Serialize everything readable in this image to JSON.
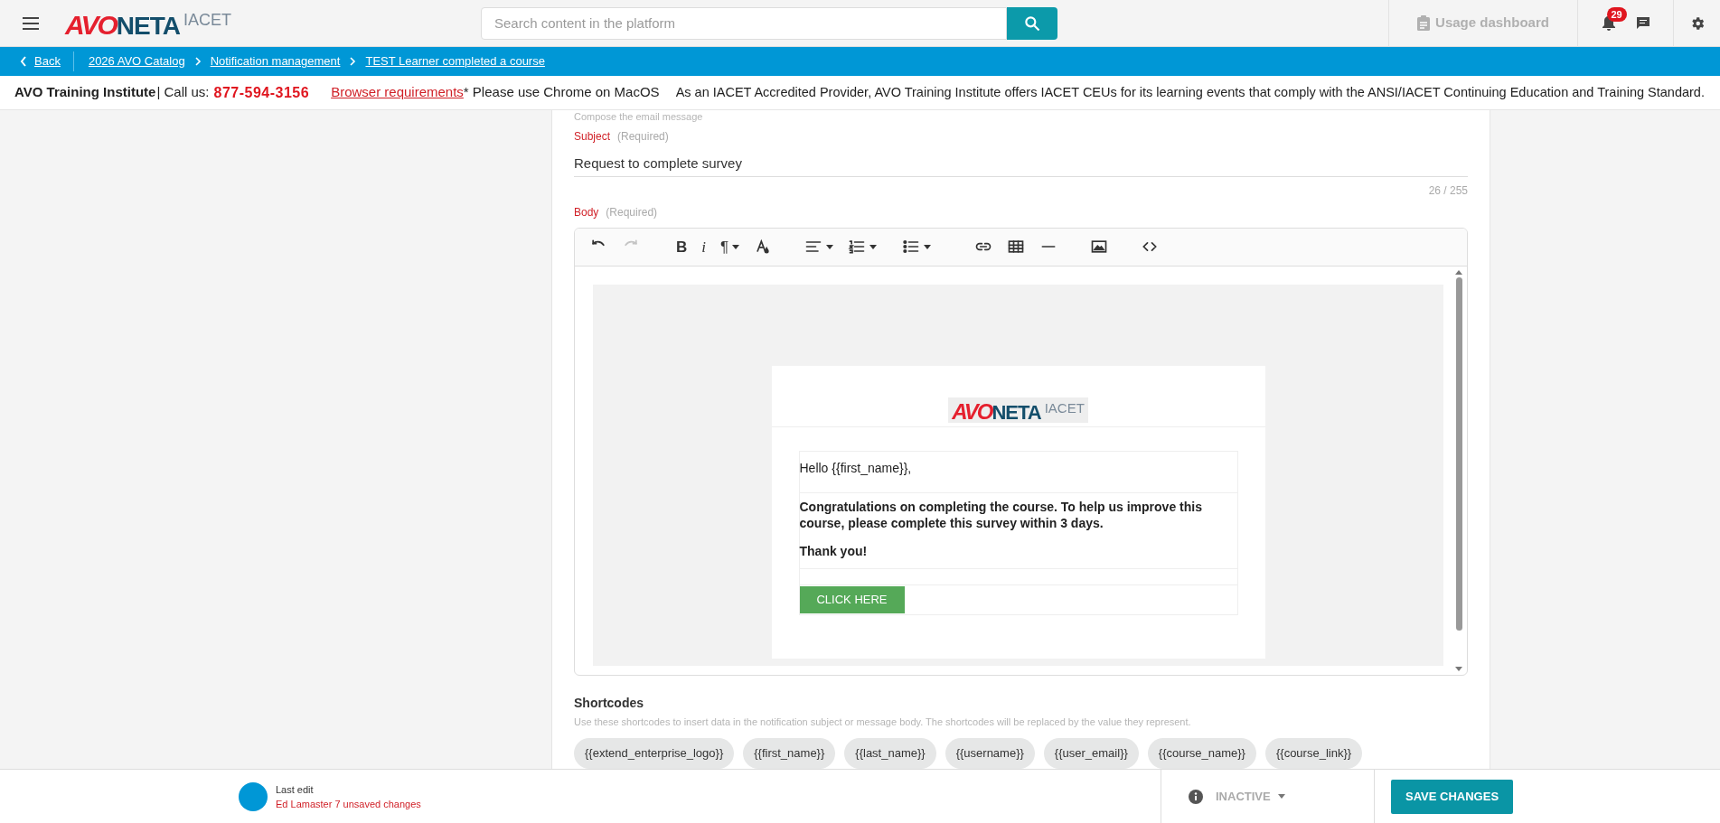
{
  "header": {
    "logo": {
      "part_1": "AVO",
      "part_2": "NETA",
      "part_3": "IACET"
    },
    "search": {
      "placeholder": "Search content in the platform"
    },
    "usage_dashboard": "Usage dashboard",
    "notifications_count": "29"
  },
  "breadcrumb": {
    "back": "Back",
    "items": [
      "2026 AVO Catalog",
      "Notification management",
      "TEST Learner completed a course"
    ]
  },
  "info_strip": {
    "institute": "AVO Training Institute",
    "call_us": "| Call us:",
    "phone": "877-594-3156",
    "browser_link": "Browser requirements",
    "browser_note": "* Please use Chrome on MacOS",
    "accreditation": "As an IACET Accredited Provider, AVO Training Institute offers IACET CEUs for its learning events that comply with the ANSI/IACET Continuing Education and Training Standard."
  },
  "form": {
    "section_hint": "Compose the email message",
    "subject": {
      "label": "Subject",
      "required": "(Required)",
      "value": "Request to complete survey",
      "counter": "26 / 255"
    },
    "body": {
      "label": "Body",
      "required": "(Required)",
      "toolbar": [
        {
          "kind": "undo",
          "disabled": false
        },
        {
          "kind": "redo",
          "disabled": true
        },
        {
          "kind": "bold",
          "text": "B",
          "disabled": false
        },
        {
          "kind": "italic",
          "text": "i",
          "disabled": false
        },
        {
          "kind": "paragraph",
          "text": "¶",
          "disabled": false,
          "dropdown": true
        },
        {
          "kind": "text-color",
          "disabled": false
        },
        {
          "kind": "align",
          "disabled": false,
          "dropdown": true
        },
        {
          "kind": "ordered-list",
          "disabled": false,
          "dropdown": true
        },
        {
          "kind": "bullet-list",
          "disabled": false,
          "dropdown": true
        },
        {
          "kind": "link",
          "disabled": false
        },
        {
          "kind": "table",
          "disabled": false
        },
        {
          "kind": "rule",
          "disabled": false
        },
        {
          "kind": "image",
          "disabled": false
        },
        {
          "kind": "code",
          "disabled": false
        }
      ],
      "email": {
        "logo": {
          "part_1": "AVO",
          "part_2": "NETA",
          "part_3": "IACET"
        },
        "greeting": "Hello {{first_name}},",
        "message": "Congratulations on completing the course. To help us improve this course, please complete this survey within 3 days.",
        "thanks": "Thank you!",
        "button": "CLICK HERE"
      }
    }
  },
  "shortcodes": {
    "title": "Shortcodes",
    "description": "Use these shortcodes to insert data in the notification subject or message body. The shortcodes will be replaced by the value they represent.",
    "items": [
      "{{extend_enterprise_logo}}",
      "{{first_name}}",
      "{{last_name}}",
      "{{username}}",
      "{{user_email}}",
      "{{course_name}}",
      "{{course_link}}"
    ]
  },
  "footer": {
    "last_edit_label": "Last edit",
    "last_edit_detail": "Ed Lamaster 7 unsaved changes",
    "status": "INACTIVE",
    "save": "SAVE CHANGES"
  }
}
